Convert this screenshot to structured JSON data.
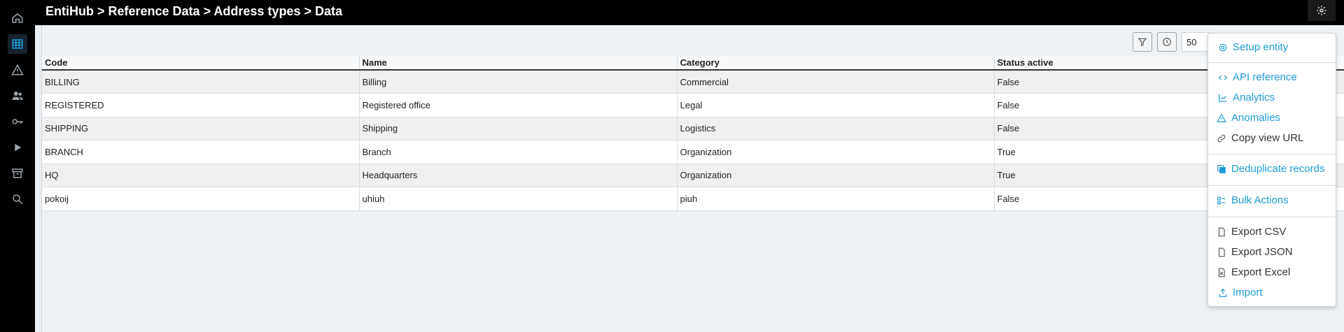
{
  "header": {
    "breadcrumb": "EntiHub > Reference Data > Address types > Data"
  },
  "sidebar": {
    "icons": [
      "home-icon",
      "table-icon",
      "warning-icon",
      "users-icon",
      "key-icon",
      "play-icon",
      "archive-icon",
      "search-icon"
    ],
    "active": "table-icon"
  },
  "toolbar": {
    "page_size": "50"
  },
  "table": {
    "headers": [
      "Code",
      "Name",
      "Category",
      "Status active"
    ],
    "rows": [
      [
        "BILLING",
        "Billing",
        "Commercial",
        "False"
      ],
      [
        "REGISTERED",
        "Registered office",
        "Legal",
        "False"
      ],
      [
        "SHIPPING",
        "Shipping",
        "Logistics",
        "False"
      ],
      [
        "BRANCH",
        "Branch",
        "Organization",
        "True"
      ],
      [
        "HQ",
        "Headquarters",
        "Organization",
        "True"
      ],
      [
        "pokoij",
        "uhiuh",
        "piuh",
        "False"
      ]
    ]
  },
  "menu": {
    "items": [
      {
        "label": "Setup entity",
        "icon": "gear-icon",
        "color": "#1e9bd7"
      },
      {
        "label": "API reference",
        "icon": "code-icon",
        "color": "#1e9bd7"
      },
      {
        "label": "Analytics",
        "icon": "chart-icon",
        "color": "#1e9bd7"
      },
      {
        "label": "Anomalies",
        "icon": "warning-icon",
        "color": "#1e9bd7"
      },
      {
        "label": "Copy view URL",
        "icon": "link-icon",
        "color": "#333333"
      },
      {
        "label": "Deduplicate records",
        "icon": "copy-icon",
        "color": "#1e9bd7"
      },
      {
        "label": "Bulk Actions",
        "icon": "list-icon",
        "color": "#1e9bd7"
      },
      {
        "label": "Export CSV",
        "icon": "file-csv-icon",
        "color": "#333333"
      },
      {
        "label": "Export JSON",
        "icon": "file-json-icon",
        "color": "#333333"
      },
      {
        "label": "Export Excel",
        "icon": "file-excel-icon",
        "color": "#333333"
      },
      {
        "label": "Import",
        "icon": "upload-icon",
        "color": "#1e9bd7"
      }
    ]
  }
}
